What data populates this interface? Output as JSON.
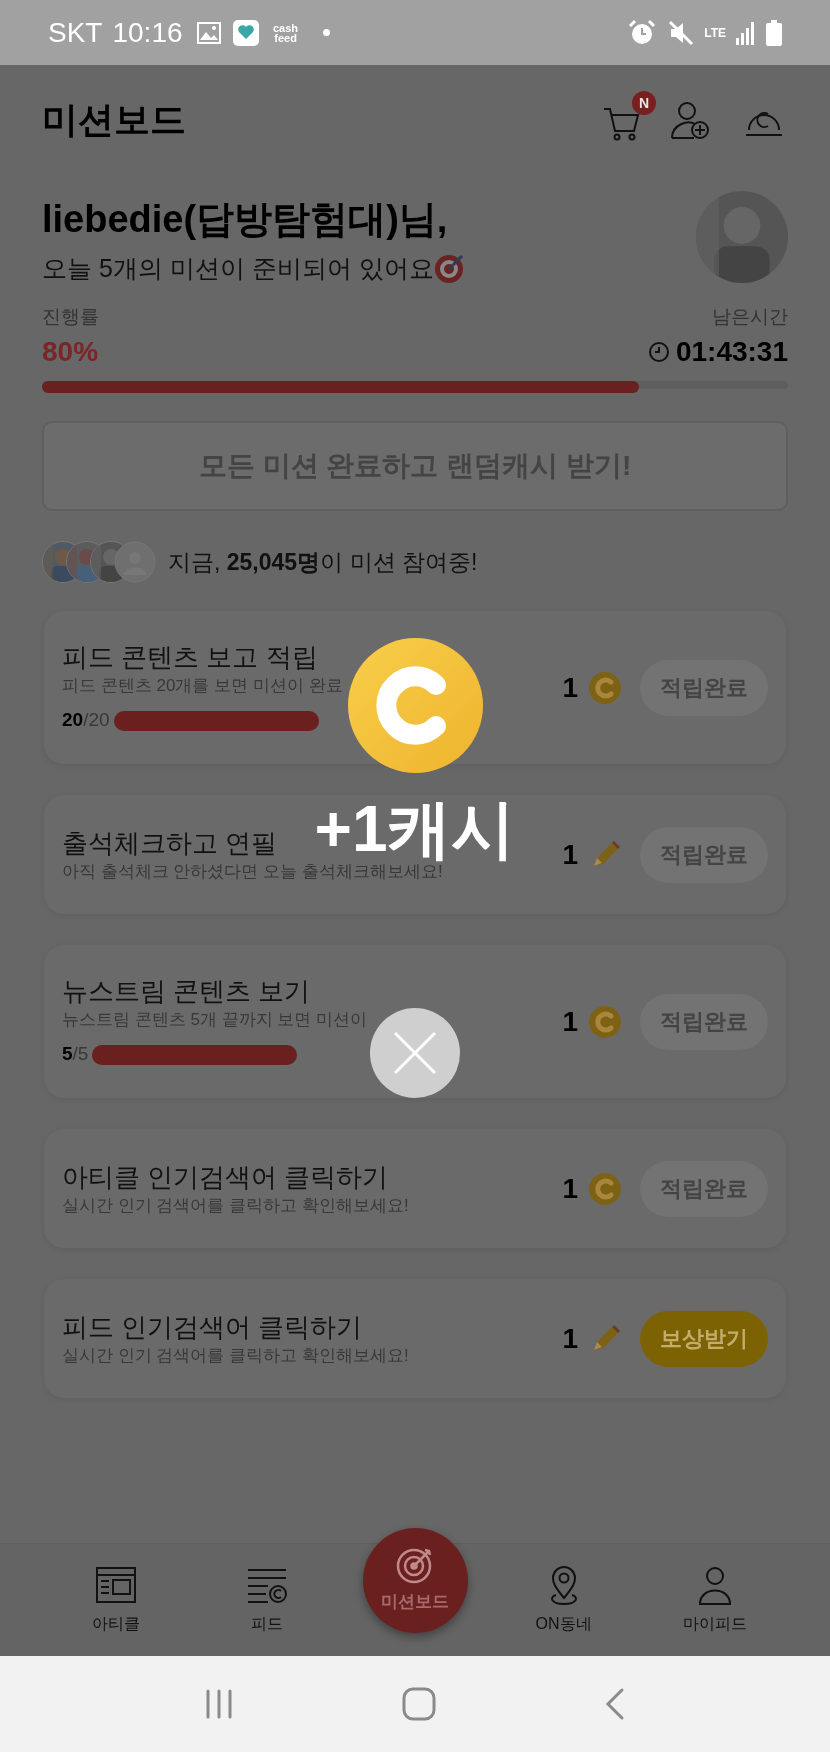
{
  "status_bar": {
    "carrier": "SKT",
    "time": "10:16",
    "app_label": "cash feed",
    "network": "LTE"
  },
  "header": {
    "title": "미션보드",
    "cart_badge": "N"
  },
  "greeting": {
    "name": "liebedie(답방탐험대)님,",
    "message": "오늘 5개의 미션이 준비되어 있어요"
  },
  "progress": {
    "label": "진행률",
    "value": "80%",
    "level": 0.8,
    "time_label": "남은시간",
    "time": "01:43:31"
  },
  "complete_button": {
    "label": "모든 미션 완료하고 랜덤캐시 받기!",
    "disabled": true
  },
  "participants": {
    "text": "지금, **25,045명**이 미션 참여중!"
  },
  "missions": [
    {
      "title": "피드 콘텐츠 보고 적립",
      "description": "피드 콘텐츠 20개를 보면 미션이 완료",
      "reward": {
        "amount": "1",
        "kind": "coin"
      },
      "progress": {
        "count": "20",
        "total": "/20",
        "level": 1
      },
      "button": {
        "label": "적립완료",
        "kind": "done"
      }
    },
    {
      "title": "출석체크하고 연필",
      "description": "아직 출석체크 안하셨다면 오늘 출석체크해보세요!",
      "reward": {
        "amount": "1",
        "kind": "pencil"
      },
      "button": {
        "label": "적립완료",
        "kind": "done"
      }
    },
    {
      "title": "뉴스트림 콘텐츠 보기",
      "description": "뉴스트림 콘텐츠 5개 끝까지 보면 미션이",
      "reward": {
        "amount": "1",
        "kind": "coin"
      },
      "progress": {
        "count": "5",
        "total": "/5",
        "level": 1
      },
      "button": {
        "label": "적립완료",
        "kind": "done"
      }
    },
    {
      "title": "아티클 인기검색어 클릭하기",
      "description": "실시간 인기 검색어를 클릭하고 확인해보세요!",
      "reward": {
        "amount": "1",
        "kind": "coin"
      },
      "button": {
        "label": "적립완료",
        "kind": "done"
      }
    },
    {
      "title": "피드 인기검색어 클릭하기",
      "description": "실시간 인기 검색어를 클릭하고 확인해보세요!",
      "reward": {
        "amount": "1",
        "kind": "pencil"
      },
      "button": {
        "label": "보상받기",
        "kind": "claim"
      }
    }
  ],
  "reward_popup": {
    "text": "+1캐시"
  },
  "bottom_nav": [
    {
      "label": "아티클",
      "selected": false
    },
    {
      "label": "피드",
      "selected": false
    },
    {
      "label": "미션보드",
      "selected": true
    },
    {
      "label": "ON동네",
      "selected": false
    },
    {
      "label": "마이피드",
      "selected": false
    }
  ]
}
